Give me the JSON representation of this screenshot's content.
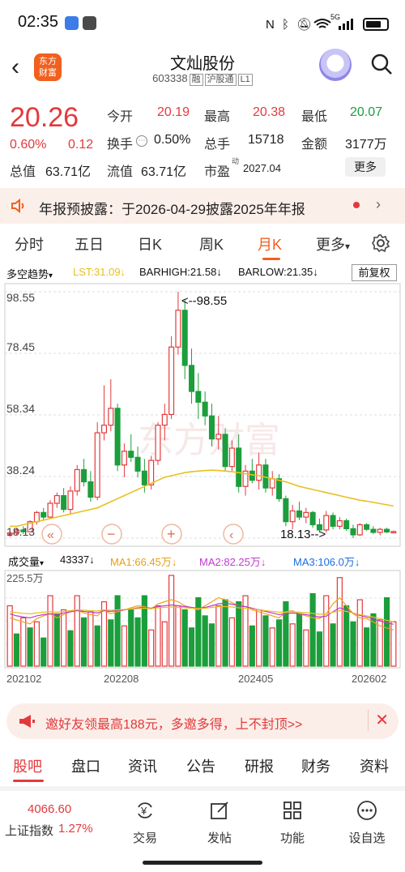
{
  "status_bar": {
    "time": "02:35",
    "network": "5G",
    "icons": [
      "nfc-icon",
      "bluetooth-icon",
      "mute-icon",
      "wifi-icon",
      "signal-icon",
      "battery-icon"
    ]
  },
  "header": {
    "logo_line1": "东方",
    "logo_line2": "财富",
    "stock_name": "文灿股份",
    "stock_code": "603338",
    "tags": [
      "融",
      "沪股通",
      "L1"
    ]
  },
  "quote": {
    "price": "20.26",
    "change_pct": "0.60%",
    "change_val": "0.12",
    "open_label": "今开",
    "open": "20.19",
    "high_label": "最高",
    "high": "20.38",
    "low_label": "最低",
    "low": "20.07",
    "turnover_label": "换手",
    "turnover": "0.50%",
    "volume_label": "总手",
    "volume": "15718",
    "amount_label": "金额",
    "amount": "3177万",
    "mktcap_label": "总值",
    "mktcap": "63.71亿",
    "float_label": "流值",
    "float": "63.71亿",
    "pe_label": "市盈",
    "pe_sup": "动",
    "pe": "2027.04",
    "more_label": "更多"
  },
  "notice": {
    "text": "年报预披露：于2026-04-29披露2025年年报"
  },
  "period_tabs": [
    "分时",
    "五日",
    "日K",
    "周K",
    "月K",
    "更多"
  ],
  "active_period": "月K",
  "kline_header": {
    "indicator": "多空趋势",
    "lst": "LST:31.09↓",
    "barhigh": "BARHIGH:21.58↓",
    "barlow": "BARLOW:21.35↓",
    "adjust": "前复权"
  },
  "kline_axis": {
    "labels": [
      "98.55",
      "78.45",
      "58.34",
      "38.24",
      "18.13"
    ]
  },
  "kline_annotations": {
    "high_mark": "<--98.55",
    "low_mark": "18.13-->"
  },
  "chart_controls": [
    "«",
    "−",
    "+",
    "‹"
  ],
  "watermark": "东方财富",
  "volume_header": {
    "label": "成交量",
    "value": "43337↓",
    "ma1": "MA1:66.45万↓",
    "ma2": "MA2:82.25万↓",
    "ma3": "MA3:106.0万↓",
    "max": "225.5万"
  },
  "date_axis": [
    "202102",
    "202208",
    "202405",
    "202602"
  ],
  "colors": {
    "up": "#e4393c",
    "down": "#1b9e3b",
    "ma_yellow": "#e8c020",
    "ma_purple": "#c03ad0",
    "ma_orange": "#f0a020",
    "accent": "#f0601f"
  },
  "promo": {
    "text": "邀好友领最高188元，多邀多得，上不封顶>>"
  },
  "bottom_tabs": [
    "股吧",
    "盘口",
    "资讯",
    "公告",
    "研报",
    "财务",
    "资料"
  ],
  "active_bottom_tab": "股吧",
  "nav": {
    "index_value": "4066.60",
    "index_name": "上证指数",
    "index_pct": "1.27%",
    "items": [
      {
        "label": "交易",
        "icon": "yuan-trade-icon"
      },
      {
        "label": "发帖",
        "icon": "edit-post-icon"
      },
      {
        "label": "功能",
        "icon": "grid-apps-icon"
      },
      {
        "label": "设自选",
        "icon": "more-dots-icon"
      }
    ]
  },
  "chart_data": [
    {
      "type": "candlestick",
      "title": "文灿股份 月K",
      "period": "monthly",
      "x_range": [
        "202102",
        "202602"
      ],
      "ylim": [
        18.13,
        98.55
      ],
      "y_ticks": [
        98.55,
        78.45,
        58.34,
        38.24,
        18.13
      ],
      "candles": [
        [
          19.5,
          20.5,
          18.5,
          19.8
        ],
        [
          19.8,
          21.5,
          19.2,
          20.8
        ],
        [
          20.8,
          22.0,
          19.5,
          20.2
        ],
        [
          20.2,
          24.0,
          20.0,
          23.5
        ],
        [
          23.5,
          27.0,
          22.5,
          26.5
        ],
        [
          26.5,
          28.0,
          24.0,
          25.0
        ],
        [
          25.0,
          30.5,
          24.5,
          29.5
        ],
        [
          29.5,
          33.0,
          28.0,
          32.0
        ],
        [
          32.0,
          34.5,
          26.5,
          27.5
        ],
        [
          27.5,
          35.0,
          26.0,
          33.5
        ],
        [
          33.5,
          42.0,
          32.0,
          40.5
        ],
        [
          40.5,
          44.0,
          35.0,
          36.5
        ],
        [
          36.5,
          40.0,
          30.0,
          31.5
        ],
        [
          31.5,
          56.0,
          30.5,
          52.5
        ],
        [
          52.5,
          68.0,
          50.0,
          55.0
        ],
        [
          55.0,
          70.0,
          53.0,
          60.5
        ],
        [
          60.5,
          62.0,
          40.0,
          42.0
        ],
        [
          42.0,
          49.0,
          38.0,
          46.5
        ],
        [
          46.5,
          52.0,
          43.0,
          44.5
        ],
        [
          44.5,
          48.0,
          38.0,
          40.0
        ],
        [
          40.0,
          44.0,
          33.0,
          35.5
        ],
        [
          35.5,
          45.0,
          34.0,
          43.5
        ],
        [
          43.5,
          56.0,
          42.0,
          55.0
        ],
        [
          55.0,
          62.0,
          50.0,
          58.5
        ],
        [
          58.5,
          84.0,
          57.0,
          80.5
        ],
        [
          80.5,
          98.55,
          78.0,
          92.5
        ],
        [
          92.5,
          96.0,
          70.0,
          74.5
        ],
        [
          74.5,
          80.0,
          62.0,
          66.0
        ],
        [
          66.0,
          72.0,
          57.0,
          62.5
        ],
        [
          62.5,
          66.0,
          55.0,
          58.0
        ],
        [
          58.0,
          62.0,
          48.0,
          50.5
        ],
        [
          50.5,
          58.0,
          47.0,
          52.0
        ],
        [
          52.0,
          54.0,
          40.0,
          41.5
        ],
        [
          41.5,
          50.0,
          40.0,
          47.5
        ],
        [
          47.5,
          52.0,
          33.0,
          35.0
        ],
        [
          35.0,
          42.0,
          32.0,
          40.0
        ],
        [
          40.0,
          44.0,
          36.0,
          37.0
        ],
        [
          37.0,
          46.0,
          34.0,
          42.0
        ],
        [
          42.0,
          44.0,
          33.0,
          34.5
        ],
        [
          34.5,
          40.0,
          32.0,
          37.5
        ],
        [
          37.5,
          39.0,
          30.0,
          31.0
        ],
        [
          31.0,
          32.0,
          22.0,
          23.5
        ],
        [
          23.5,
          29.0,
          21.0,
          27.0
        ],
        [
          27.0,
          30.0,
          24.0,
          25.0
        ],
        [
          25.0,
          28.0,
          23.0,
          26.5
        ],
        [
          26.5,
          27.0,
          21.5,
          22.5
        ],
        [
          22.5,
          24.5,
          20.0,
          20.8
        ],
        [
          20.8,
          27.0,
          20.0,
          25.5
        ],
        [
          25.5,
          26.5,
          21.0,
          22.0
        ],
        [
          22.0,
          25.0,
          21.0,
          23.8
        ],
        [
          23.8,
          24.5,
          20.5,
          21.2
        ],
        [
          21.2,
          22.5,
          18.13,
          19.2
        ],
        [
          19.2,
          23.0,
          18.8,
          22.5
        ],
        [
          22.5,
          23.0,
          20.5,
          21.0
        ],
        [
          21.0,
          22.0,
          19.5,
          20.0
        ],
        [
          20.0,
          21.5,
          19.0,
          21.0
        ],
        [
          21.0,
          21.5,
          19.8,
          20.14
        ],
        [
          20.14,
          20.6,
          19.8,
          20.26
        ]
      ],
      "ma_line": [
        22,
        22,
        22.5,
        23,
        23.5,
        24,
        24.5,
        25,
        25.5,
        26,
        26.5,
        27,
        27.5,
        28,
        29,
        30,
        31,
        32,
        33,
        34,
        35,
        36,
        37,
        38,
        38.5,
        39,
        39.5,
        39.8,
        40,
        40.2,
        40.3,
        40.2,
        40,
        39.8,
        39.5,
        39.2,
        38.8,
        38.5,
        38,
        37.5,
        37,
        36.5,
        35.8,
        35,
        34.5,
        34,
        33.5,
        33,
        32.5,
        32,
        31.5,
        31,
        30.5,
        30.2,
        29.8,
        29.4,
        29,
        28.6
      ]
    },
    {
      "type": "bar",
      "title": "成交量",
      "ylim": [
        0,
        225.5
      ],
      "unit": "万",
      "values": [
        150,
        80,
        120,
        95,
        110,
        70,
        175,
        130,
        140,
        88,
        175,
        120,
        135,
        100,
        160,
        115,
        175,
        100,
        140,
        120,
        175,
        90,
        150,
        110,
        225.5,
        150,
        140,
        95,
        170,
        125,
        105,
        150,
        165,
        120,
        160,
        175,
        100,
        140,
        125,
        95,
        115,
        160,
        105,
        130,
        90,
        180,
        85,
        175,
        105,
        220,
        150,
        110,
        165,
        95,
        130,
        115,
        170,
        110
      ],
      "up": [
        1,
        0,
        1,
        0,
        1,
        0,
        1,
        0,
        1,
        0,
        1,
        0,
        1,
        0,
        1,
        0,
        0,
        1,
        0,
        0,
        0,
        1,
        1,
        1,
        1,
        1,
        0,
        0,
        0,
        0,
        0,
        1,
        0,
        1,
        0,
        1,
        0,
        1,
        0,
        1,
        0,
        0,
        1,
        0,
        1,
        0,
        0,
        1,
        0,
        1,
        0,
        0,
        1,
        0,
        0,
        1,
        0,
        1
      ],
      "ma1": [
        120,
        115,
        110,
        105,
        118,
        125,
        130,
        120,
        128,
        135,
        140,
        132,
        128,
        125,
        140,
        130,
        135,
        140,
        145,
        150,
        148,
        142,
        155,
        160,
        165,
        160,
        150,
        145,
        140,
        150,
        160,
        170,
        165,
        158,
        150,
        148,
        140,
        135,
        130,
        125,
        120,
        135,
        138,
        130,
        125,
        120,
        118,
        130,
        155,
        170,
        150,
        130,
        120,
        118,
        110,
        100,
        95,
        90
      ],
      "ma2": [
        130,
        125,
        122,
        120,
        125,
        128,
        130,
        128,
        132,
        135,
        138,
        136,
        134,
        132,
        138,
        136,
        138,
        140,
        142,
        145,
        146,
        144,
        148,
        150,
        152,
        150,
        148,
        146,
        144,
        146,
        150,
        155,
        156,
        154,
        150,
        148,
        144,
        140,
        136,
        132,
        128,
        130,
        132,
        130,
        128,
        125,
        122,
        124,
        135,
        145,
        140,
        132,
        126,
        122,
        118,
        112,
        108,
        104
      ],
      "ma3": [
        135,
        133,
        131,
        130,
        132,
        134,
        135,
        134,
        136,
        138,
        140,
        139,
        138,
        137,
        140,
        139,
        140,
        141,
        142,
        143,
        144,
        143,
        145,
        146,
        147,
        146,
        145,
        144,
        143,
        144,
        146,
        148,
        148,
        147,
        145,
        144,
        142,
        140,
        138,
        136,
        134,
        134,
        135,
        134,
        133,
        131,
        129,
        129,
        134,
        138,
        136,
        132,
        128,
        125,
        122,
        118,
        114,
        110
      ]
    }
  ]
}
